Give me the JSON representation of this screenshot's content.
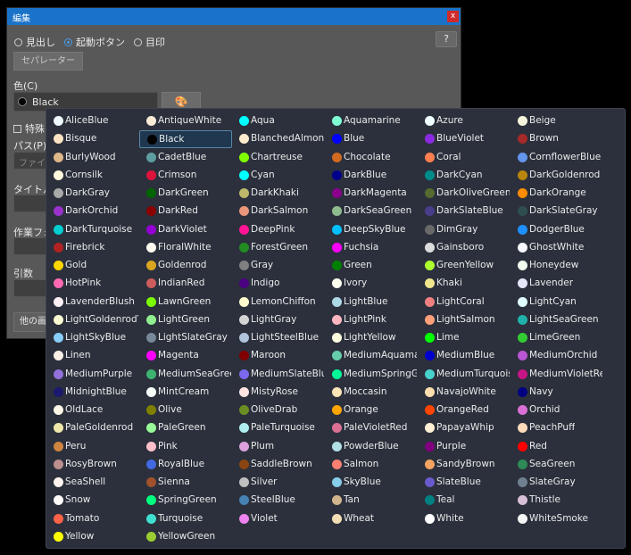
{
  "window": {
    "title": "編集",
    "close_label": "x",
    "radios": [
      "見出し",
      "起動ボタン",
      "目印"
    ],
    "selected_radio": 1,
    "help_label": "?",
    "separator_button": "セパレーター",
    "color_label": "色(C)",
    "color_value": "Black",
    "palette_icon": "palette-icon",
    "special_checkbox": "特殊",
    "path_label": "パス(P)",
    "path_placeholder": "ファイル",
    "title_label": "タイトル",
    "workdir_label": "作業フォ",
    "args_label": "引数",
    "other_button": "他の画"
  },
  "colors": [
    [
      "AliceBlue",
      "#F0F8FF"
    ],
    [
      "AntiqueWhite",
      "#FAEBD7"
    ],
    [
      "Aqua",
      "#00FFFF"
    ],
    [
      "Aquamarine",
      "#7FFFD4"
    ],
    [
      "Azure",
      "#F0FFFF"
    ],
    [
      "Beige",
      "#F5F5DC"
    ],
    [
      "Bisque",
      "#FFE4C4"
    ],
    [
      "Black",
      "#000000"
    ],
    [
      "BlanchedAlmond",
      "#FFEBCD"
    ],
    [
      "Blue",
      "#0000FF"
    ],
    [
      "BlueViolet",
      "#8A2BE2"
    ],
    [
      "Brown",
      "#A52A2A"
    ],
    [
      "BurlyWood",
      "#DEB887"
    ],
    [
      "CadetBlue",
      "#5F9EA0"
    ],
    [
      "Chartreuse",
      "#7FFF00"
    ],
    [
      "Chocolate",
      "#D2691E"
    ],
    [
      "Coral",
      "#FF7F50"
    ],
    [
      "CornflowerBlue",
      "#6495ED"
    ],
    [
      "Cornsilk",
      "#FFF8DC"
    ],
    [
      "Crimson",
      "#DC143C"
    ],
    [
      "Cyan",
      "#00FFFF"
    ],
    [
      "DarkBlue",
      "#00008B"
    ],
    [
      "DarkCyan",
      "#008B8B"
    ],
    [
      "DarkGoldenrod",
      "#B8860B"
    ],
    [
      "DarkGray",
      "#A9A9A9"
    ],
    [
      "DarkGreen",
      "#006400"
    ],
    [
      "DarkKhaki",
      "#BDB76B"
    ],
    [
      "DarkMagenta",
      "#8B008B"
    ],
    [
      "DarkOliveGreen",
      "#556B2F"
    ],
    [
      "DarkOrange",
      "#FF8C00"
    ],
    [
      "DarkOrchid",
      "#9932CC"
    ],
    [
      "DarkRed",
      "#8B0000"
    ],
    [
      "DarkSalmon",
      "#E9967A"
    ],
    [
      "DarkSeaGreen",
      "#8FBC8F"
    ],
    [
      "DarkSlateBlue",
      "#483D8B"
    ],
    [
      "DarkSlateGray",
      "#2F4F4F"
    ],
    [
      "DarkTurquoise",
      "#00CED1"
    ],
    [
      "DarkViolet",
      "#9400D3"
    ],
    [
      "DeepPink",
      "#FF1493"
    ],
    [
      "DeepSkyBlue",
      "#00BFFF"
    ],
    [
      "DimGray",
      "#696969"
    ],
    [
      "DodgerBlue",
      "#1E90FF"
    ],
    [
      "Firebrick",
      "#B22222"
    ],
    [
      "FloralWhite",
      "#FFFAF0"
    ],
    [
      "ForestGreen",
      "#228B22"
    ],
    [
      "Fuchsia",
      "#FF00FF"
    ],
    [
      "Gainsboro",
      "#DCDCDC"
    ],
    [
      "GhostWhite",
      "#F8F8FF"
    ],
    [
      "Gold",
      "#FFD700"
    ],
    [
      "Goldenrod",
      "#DAA520"
    ],
    [
      "Gray",
      "#808080"
    ],
    [
      "Green",
      "#008000"
    ],
    [
      "GreenYellow",
      "#ADFF2F"
    ],
    [
      "Honeydew",
      "#F0FFF0"
    ],
    [
      "HotPink",
      "#FF69B4"
    ],
    [
      "IndianRed",
      "#CD5C5C"
    ],
    [
      "Indigo",
      "#4B0082"
    ],
    [
      "Ivory",
      "#FFFFF0"
    ],
    [
      "Khaki",
      "#F0E68C"
    ],
    [
      "Lavender",
      "#E6E6FA"
    ],
    [
      "LavenderBlush",
      "#FFF0F5"
    ],
    [
      "LawnGreen",
      "#7CFC00"
    ],
    [
      "LemonChiffon",
      "#FFFACD"
    ],
    [
      "LightBlue",
      "#ADD8E6"
    ],
    [
      "LightCoral",
      "#F08080"
    ],
    [
      "LightCyan",
      "#E0FFFF"
    ],
    [
      "LightGoldenrodYe",
      "#FAFAD2"
    ],
    [
      "LightGreen",
      "#90EE90"
    ],
    [
      "LightGray",
      "#D3D3D3"
    ],
    [
      "LightPink",
      "#FFB6C1"
    ],
    [
      "LightSalmon",
      "#FFA07A"
    ],
    [
      "LightSeaGreen",
      "#20B2AA"
    ],
    [
      "LightSkyBlue",
      "#87CEFA"
    ],
    [
      "LightSlateGray",
      "#778899"
    ],
    [
      "LightSteelBlue",
      "#B0C4DE"
    ],
    [
      "LightYellow",
      "#FFFFE0"
    ],
    [
      "Lime",
      "#00FF00"
    ],
    [
      "LimeGreen",
      "#32CD32"
    ],
    [
      "Linen",
      "#FAF0E6"
    ],
    [
      "Magenta",
      "#FF00FF"
    ],
    [
      "Maroon",
      "#800000"
    ],
    [
      "MediumAquamari",
      "#66CDAA"
    ],
    [
      "MediumBlue",
      "#0000CD"
    ],
    [
      "MediumOrchid",
      "#BA55D3"
    ],
    [
      "MediumPurple",
      "#9370DB"
    ],
    [
      "MediumSeaGreen",
      "#3CB371"
    ],
    [
      "MediumSlateBlue",
      "#7B68EE"
    ],
    [
      "MediumSpringGre",
      "#00FA9A"
    ],
    [
      "MediumTurquoise",
      "#48D1CC"
    ],
    [
      "MediumVioletRed",
      "#C71585"
    ],
    [
      "MidnightBlue",
      "#191970"
    ],
    [
      "MintCream",
      "#F5FFFA"
    ],
    [
      "MistyRose",
      "#FFE4E1"
    ],
    [
      "Moccasin",
      "#FFE4B5"
    ],
    [
      "NavajoWhite",
      "#FFDEAD"
    ],
    [
      "Navy",
      "#000080"
    ],
    [
      "OldLace",
      "#FDF5E6"
    ],
    [
      "Olive",
      "#808000"
    ],
    [
      "OliveDrab",
      "#6B8E23"
    ],
    [
      "Orange",
      "#FFA500"
    ],
    [
      "OrangeRed",
      "#FF4500"
    ],
    [
      "Orchid",
      "#DA70D6"
    ],
    [
      "PaleGoldenrod",
      "#EEE8AA"
    ],
    [
      "PaleGreen",
      "#98FB98"
    ],
    [
      "PaleTurquoise",
      "#AFEEEE"
    ],
    [
      "PaleVioletRed",
      "#DB7093"
    ],
    [
      "PapayaWhip",
      "#FFEFD5"
    ],
    [
      "PeachPuff",
      "#FFDAB9"
    ],
    [
      "Peru",
      "#CD853F"
    ],
    [
      "Pink",
      "#FFC0CB"
    ],
    [
      "Plum",
      "#DDA0DD"
    ],
    [
      "PowderBlue",
      "#B0E0E6"
    ],
    [
      "Purple",
      "#800080"
    ],
    [
      "Red",
      "#FF0000"
    ],
    [
      "RosyBrown",
      "#BC8F8F"
    ],
    [
      "RoyalBlue",
      "#4169E1"
    ],
    [
      "SaddleBrown",
      "#8B4513"
    ],
    [
      "Salmon",
      "#FA8072"
    ],
    [
      "SandyBrown",
      "#F4A460"
    ],
    [
      "SeaGreen",
      "#2E8B57"
    ],
    [
      "SeaShell",
      "#FFF5EE"
    ],
    [
      "Sienna",
      "#A0522D"
    ],
    [
      "Silver",
      "#C0C0C0"
    ],
    [
      "SkyBlue",
      "#87CEEB"
    ],
    [
      "SlateBlue",
      "#6A5ACD"
    ],
    [
      "SlateGray",
      "#708090"
    ],
    [
      "Snow",
      "#FFFAFA"
    ],
    [
      "SpringGreen",
      "#00FF7F"
    ],
    [
      "SteelBlue",
      "#4682B4"
    ],
    [
      "Tan",
      "#D2B48C"
    ],
    [
      "Teal",
      "#008080"
    ],
    [
      "Thistle",
      "#D8BFD8"
    ],
    [
      "Tomato",
      "#FF6347"
    ],
    [
      "Turquoise",
      "#40E0D0"
    ],
    [
      "Violet",
      "#EE82EE"
    ],
    [
      "Wheat",
      "#F5DEB3"
    ],
    [
      "White",
      "#FFFFFF"
    ],
    [
      "WhiteSmoke",
      "#F5F5F5"
    ],
    [
      "Yellow",
      "#FFFF00"
    ],
    [
      "YellowGreen",
      "#9ACD32"
    ]
  ],
  "selected_color": "Black"
}
